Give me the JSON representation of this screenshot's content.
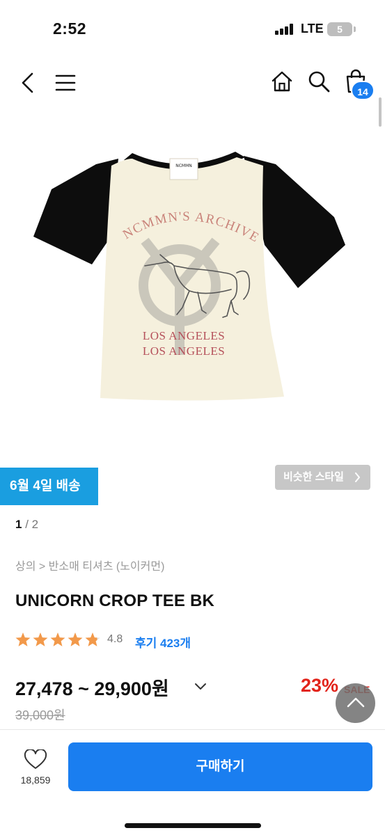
{
  "status_bar": {
    "time": "2:52",
    "network": "LTE",
    "battery": "5"
  },
  "nav": {
    "cart_count": "14"
  },
  "product_image": {
    "arch_text": "NCMMN'S ARCHIVE",
    "city_line_1": "LOS ANGELES",
    "city_line_2": "LOS ANGELES",
    "tag_brand": "NCMMN"
  },
  "delivery_badge": "6월 4일 배송",
  "similar_style_button": "비슷한 스타일",
  "pager": {
    "current": "1",
    "separator": " / ",
    "total": "2"
  },
  "breadcrumb": "상의 > 반소매 티셔츠 (노이커먼)",
  "product": {
    "title": "UNICORN CROP TEE BK",
    "rating": "4.8",
    "rating_value": 4.8,
    "reviews": "후기 423개",
    "price_range": "27,478 ~ 29,900원",
    "discount": "23%",
    "sale_label": "SALE",
    "original_price": "39,000원"
  },
  "bottom": {
    "wish_count": "18,859",
    "buy_label": "구매하기"
  },
  "colors": {
    "accent": "#1a7ef0",
    "delivery": "#1a9ee0",
    "sale": "#e2231a",
    "star": "#f2994a"
  }
}
